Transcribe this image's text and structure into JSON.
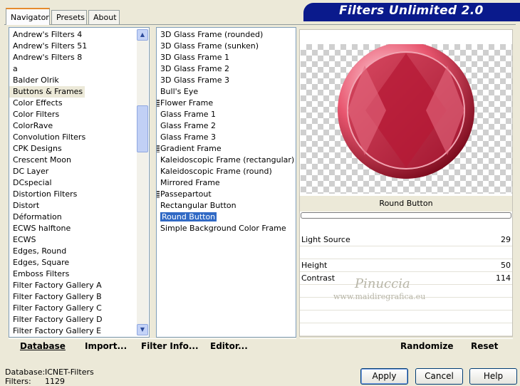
{
  "tabs": [
    "Navigator",
    "Presets",
    "About"
  ],
  "banner_title": "Filters Unlimited 2.0",
  "categories": [
    "Andrew's Filters 4",
    "Andrew's Filters 51",
    "Andrew's Filters 8",
    "a",
    "Balder Olrik",
    "Buttons & Frames",
    "Color Effects",
    "Color Filters",
    "ColorRave",
    "Convolution Filters",
    "CPK Designs",
    "Crescent Moon",
    "DC Layer",
    "DCspecial",
    "Distortion Filters",
    "Distort",
    "Déformation",
    "ECWS halftone",
    "ECWS",
    "Edges, Round",
    "Edges, Square",
    "Emboss Filters",
    "Filter Factory Gallery A",
    "Filter Factory Gallery B",
    "Filter Factory Gallery C",
    "Filter Factory Gallery D",
    "Filter Factory Gallery E"
  ],
  "selected_category": "Buttons & Frames",
  "filters": [
    {
      "name": "3D Glass Frame (rounded)",
      "marked": false
    },
    {
      "name": "3D Glass Frame (sunken)",
      "marked": false
    },
    {
      "name": "3D Glass Frame 1",
      "marked": false
    },
    {
      "name": "3D Glass Frame 2",
      "marked": false
    },
    {
      "name": "3D Glass Frame 3",
      "marked": false
    },
    {
      "name": "Bull's Eye",
      "marked": false
    },
    {
      "name": "Flower Frame",
      "marked": true
    },
    {
      "name": "Glass Frame 1",
      "marked": false
    },
    {
      "name": "Glass Frame 2",
      "marked": false
    },
    {
      "name": "Glass Frame 3",
      "marked": false
    },
    {
      "name": "Gradient Frame",
      "marked": true
    },
    {
      "name": "Kaleidoscopic Frame (rectangular)",
      "marked": false
    },
    {
      "name": "Kaleidoscopic Frame (round)",
      "marked": false
    },
    {
      "name": "Mirrored Frame",
      "marked": false
    },
    {
      "name": "Passepartout",
      "marked": true
    },
    {
      "name": "Rectangular Button",
      "marked": false
    },
    {
      "name": "Round Button",
      "marked": false
    },
    {
      "name": "Simple Background Color Frame",
      "marked": false
    }
  ],
  "selected_filter": "Round Button",
  "preview": {
    "filter_name": "Round Button",
    "progress": 0
  },
  "sliders": [
    {
      "label": "Light Source",
      "value": "29"
    },
    {
      "label": "Height",
      "value": "50"
    },
    {
      "label": "Contrast",
      "value": "114"
    }
  ],
  "watermark": {
    "line1": "Pinuccia",
    "line2": "www.maidiregrafica.eu"
  },
  "left_buttons": [
    {
      "label": "Database",
      "underline": "D"
    },
    {
      "label": "Import...",
      "underline": "I"
    },
    {
      "label": "Filter Info...",
      "underline": "F"
    },
    {
      "label": "Editor...",
      "underline": "E"
    }
  ],
  "right_buttons": [
    "Randomize",
    "Reset"
  ],
  "dialog_buttons": [
    "Apply",
    "Cancel",
    "Help"
  ],
  "status": {
    "database_label": "Database:",
    "database_value": "ICNET-Filters",
    "filters_label": "Filters:",
    "filters_value": "1129"
  },
  "colors": {
    "banner": "#0a1a8c",
    "selection": "#316ac5",
    "button_red": "#c0203c"
  },
  "icons": {
    "scroll_up": "up-arrow-icon",
    "scroll_down": "down-arrow-icon"
  }
}
